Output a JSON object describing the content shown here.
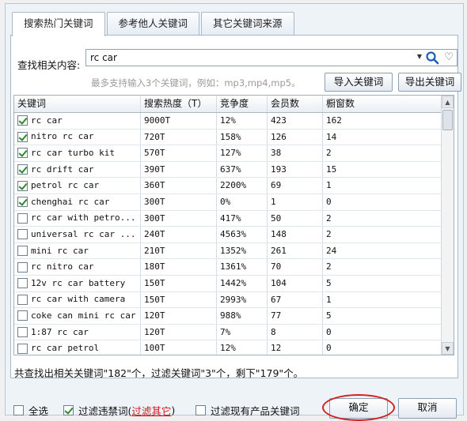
{
  "tabs": [
    {
      "label": "搜索热门关键词",
      "active": true
    },
    {
      "label": "参考他人关键词",
      "active": false
    },
    {
      "label": "其它关键词来源",
      "active": false
    }
  ],
  "search": {
    "label": "查找相关内容:",
    "value": "rc car",
    "hint": "最多支持输入3个关键词，例如：mp3,mp4,mp5。"
  },
  "buttons": {
    "import": "导入关键词",
    "export": "导出关键词",
    "confirm": "确定",
    "cancel": "取消"
  },
  "table": {
    "headers": [
      "关键词",
      "搜索热度（T）",
      "竞争度",
      "会员数",
      "橱窗数"
    ],
    "rows": [
      {
        "checked": true,
        "keyword": "rc car",
        "heat": "9000T",
        "competition": "12%",
        "members": "423",
        "showcase": "162"
      },
      {
        "checked": true,
        "keyword": "nitro rc car",
        "heat": "720T",
        "competition": "158%",
        "members": "126",
        "showcase": "14"
      },
      {
        "checked": true,
        "keyword": "rc car turbo kit",
        "heat": "570T",
        "competition": "127%",
        "members": "38",
        "showcase": "2"
      },
      {
        "checked": true,
        "keyword": "rc drift car",
        "heat": "390T",
        "competition": "637%",
        "members": "193",
        "showcase": "15"
      },
      {
        "checked": true,
        "keyword": "petrol rc car",
        "heat": "360T",
        "competition": "2200%",
        "members": "69",
        "showcase": "1"
      },
      {
        "checked": true,
        "keyword": "chenghai rc car",
        "heat": "300T",
        "competition": "0%",
        "members": "1",
        "showcase": "0"
      },
      {
        "checked": false,
        "keyword": "rc car with petro...",
        "heat": "300T",
        "competition": "417%",
        "members": "50",
        "showcase": "2"
      },
      {
        "checked": false,
        "keyword": "universal rc car ...",
        "heat": "240T",
        "competition": "4563%",
        "members": "148",
        "showcase": "2"
      },
      {
        "checked": false,
        "keyword": "mini rc car",
        "heat": "210T",
        "competition": "1352%",
        "members": "261",
        "showcase": "24"
      },
      {
        "checked": false,
        "keyword": "rc nitro car",
        "heat": "180T",
        "competition": "1361%",
        "members": "70",
        "showcase": "2"
      },
      {
        "checked": false,
        "keyword": "12v rc car battery",
        "heat": "150T",
        "competition": "1442%",
        "members": "104",
        "showcase": "5"
      },
      {
        "checked": false,
        "keyword": "rc car with camera",
        "heat": "150T",
        "competition": "2993%",
        "members": "67",
        "showcase": "1"
      },
      {
        "checked": false,
        "keyword": "coke can mini rc car",
        "heat": "120T",
        "competition": "988%",
        "members": "77",
        "showcase": "5"
      },
      {
        "checked": false,
        "keyword": "1:87 rc car",
        "heat": "120T",
        "competition": "7%",
        "members": "8",
        "showcase": "0"
      },
      {
        "checked": false,
        "keyword": "rc car petrol",
        "heat": "100T",
        "competition": "12%",
        "members": "12",
        "showcase": "0"
      }
    ]
  },
  "summary": "共查找出相关关键词\"182\"个，过滤关键词\"3\"个，剩下\"179\"个。",
  "footer": {
    "select_all": "全选",
    "filter_prefix": "过滤违禁词(",
    "filter_link": "过滤其它",
    "filter_suffix": ")",
    "filter_product": "过滤现有产品关键词"
  },
  "colors": {
    "accent_red": "#d42020",
    "check_green": "#2a8a2a"
  },
  "icons": {
    "search": "magnifier-icon",
    "favorite": "heart-icon",
    "dropdown": "triangle-down-icon"
  }
}
